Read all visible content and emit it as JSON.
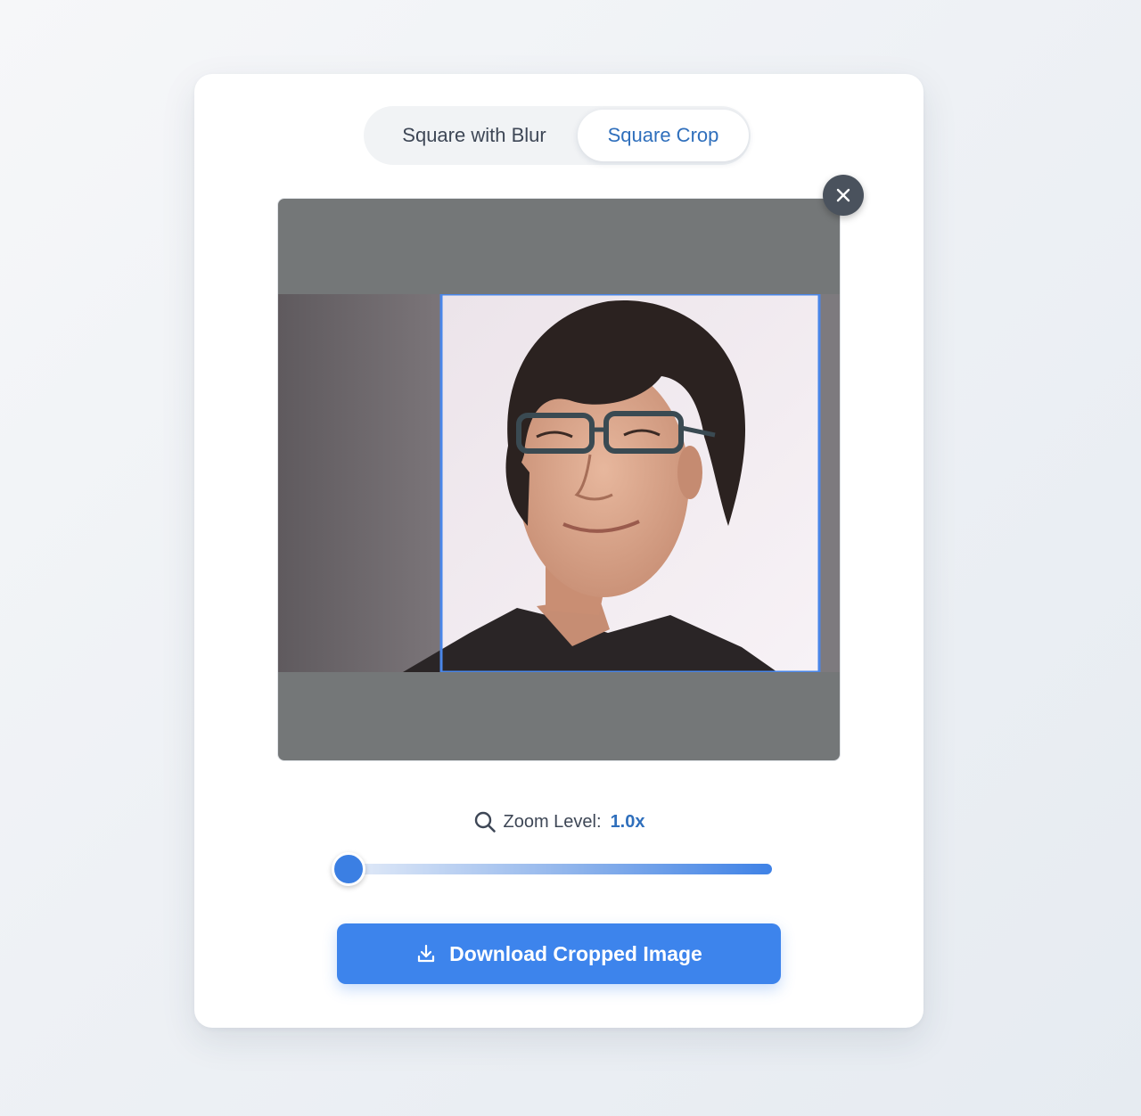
{
  "mode_toggle": {
    "options": [
      {
        "label": "Square with Blur",
        "active": false
      },
      {
        "label": "Square Crop",
        "active": true
      }
    ]
  },
  "editor": {
    "close_icon": "close-icon",
    "photo_description": "portrait photo with square crop selection"
  },
  "zoom": {
    "icon": "search-icon",
    "label": "Zoom Level:",
    "value": "1.0x",
    "slider_value": 1.0,
    "slider_min": 1.0,
    "slider_fraction": 0.0
  },
  "actions": {
    "download_label": "Download Cropped Image",
    "download_icon": "download-icon"
  },
  "colors": {
    "accent": "#3d84ec",
    "active_tab_text": "#2f6fbc",
    "crop_border": "#4a86e8",
    "stage_bg": "#747778"
  }
}
